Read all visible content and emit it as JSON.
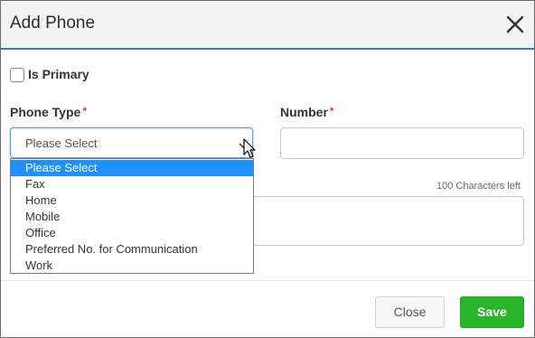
{
  "dialog": {
    "title": "Add Phone"
  },
  "is_primary": {
    "label": "Is Primary",
    "checked": false
  },
  "phone_type": {
    "label": "Phone Type",
    "required_mark": "*",
    "selected": "Please Select",
    "options": [
      "Please Select",
      "Fax",
      "Home",
      "Mobile",
      "Office",
      "Preferred No. for Communication",
      "Work"
    ]
  },
  "number": {
    "label": "Number",
    "required_mark": "*",
    "value": ""
  },
  "notes": {
    "chars_left": "100 Characters left",
    "value": ""
  },
  "footer": {
    "close_label": "Close",
    "save_label": "Save"
  },
  "colors": {
    "accent": "#2e7fc2",
    "selected_option": "#1e90ff",
    "save_button": "#2ab42a",
    "required": "#e0344a"
  }
}
